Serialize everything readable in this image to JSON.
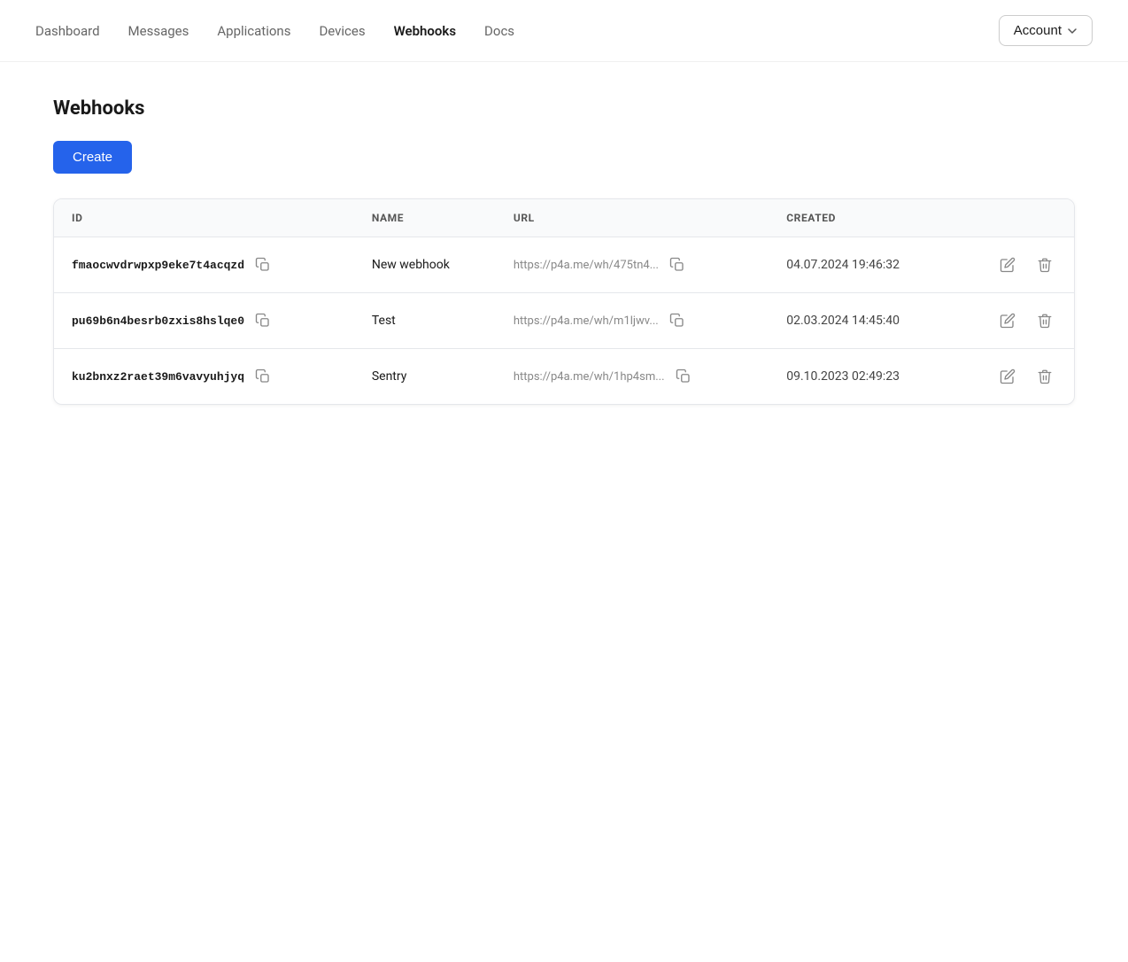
{
  "nav": {
    "links": [
      {
        "label": "Dashboard",
        "active": false
      },
      {
        "label": "Messages",
        "active": false
      },
      {
        "label": "Applications",
        "active": false
      },
      {
        "label": "Devices",
        "active": false
      },
      {
        "label": "Webhooks",
        "active": true
      },
      {
        "label": "Docs",
        "active": false
      }
    ],
    "account_label": "Account"
  },
  "page": {
    "title": "Webhooks",
    "create_label": "Create"
  },
  "table": {
    "columns": [
      "ID",
      "NAME",
      "URL",
      "CREATED"
    ],
    "rows": [
      {
        "id": "fmaocwvdrwpxp9eke7t4acqzd",
        "name": "New webhook",
        "url": "https://p4a.me/wh/475tn4...",
        "created": "04.07.2024 19:46:32"
      },
      {
        "id": "pu69b6n4besrb0zxis8hslqe0",
        "name": "Test",
        "url": "https://p4a.me/wh/m1ljwv...",
        "created": "02.03.2024 14:45:40"
      },
      {
        "id": "ku2bnxz2raet39m6vavyuhjyq",
        "name": "Sentry",
        "url": "https://p4a.me/wh/1hp4sm...",
        "created": "09.10.2023 02:49:23"
      }
    ]
  }
}
